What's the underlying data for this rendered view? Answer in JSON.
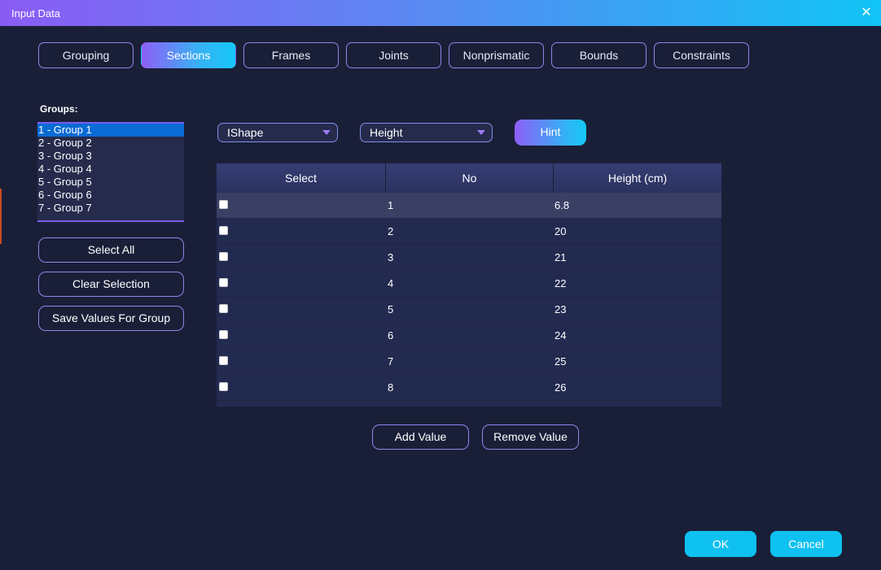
{
  "window": {
    "title": "Input Data",
    "close_glyph": "✕",
    "gradient_colors": [
      "#8a5cf5",
      "#11c4f5"
    ]
  },
  "tabs": [
    {
      "label": "Grouping",
      "active": false
    },
    {
      "label": "Sections",
      "active": true
    },
    {
      "label": "Frames",
      "active": false
    },
    {
      "label": "Joints",
      "active": false
    },
    {
      "label": "Nonprismatic",
      "active": false
    },
    {
      "label": "Bounds",
      "active": false
    },
    {
      "label": "Constraints",
      "active": false
    }
  ],
  "groups": {
    "label": "Groups:",
    "items": [
      {
        "label": "1 - Group 1",
        "selected": true
      },
      {
        "label": "2 - Group 2",
        "selected": false
      },
      {
        "label": "3 - Group 3",
        "selected": false
      },
      {
        "label": "4 - Group 4",
        "selected": false
      },
      {
        "label": "5 - Group 5",
        "selected": false
      },
      {
        "label": "6 - Group 6",
        "selected": false
      },
      {
        "label": "7 - Group 7",
        "selected": false
      }
    ]
  },
  "side_buttons": {
    "select_all": "Select All",
    "clear_selection": "Clear Selection",
    "save_values": "Save Values For Group"
  },
  "section_type": {
    "selected": "IShape",
    "icon": "chevron-down-icon"
  },
  "property": {
    "selected": "Height",
    "icon": "chevron-down-icon"
  },
  "hint_button": "Hint",
  "table": {
    "headers": [
      "Select",
      "No",
      "Height (cm)"
    ],
    "rows": [
      {
        "checked": false,
        "no": "1",
        "value": "6.8"
      },
      {
        "checked": false,
        "no": "2",
        "value": "20"
      },
      {
        "checked": false,
        "no": "3",
        "value": "21"
      },
      {
        "checked": false,
        "no": "4",
        "value": "22"
      },
      {
        "checked": false,
        "no": "5",
        "value": "23"
      },
      {
        "checked": false,
        "no": "6",
        "value": "24"
      },
      {
        "checked": false,
        "no": "7",
        "value": "25"
      },
      {
        "checked": false,
        "no": "8",
        "value": "26"
      }
    ]
  },
  "value_buttons": {
    "add": "Add Value",
    "remove": "Remove Value"
  },
  "dialog_buttons": {
    "ok": "OK",
    "cancel": "Cancel"
  },
  "colors": {
    "background": "#1a1f38",
    "accent_cyan": "#0fc1f0",
    "accent_purple": "#8e5ff6",
    "selection_blue": "#0a6bd4"
  }
}
